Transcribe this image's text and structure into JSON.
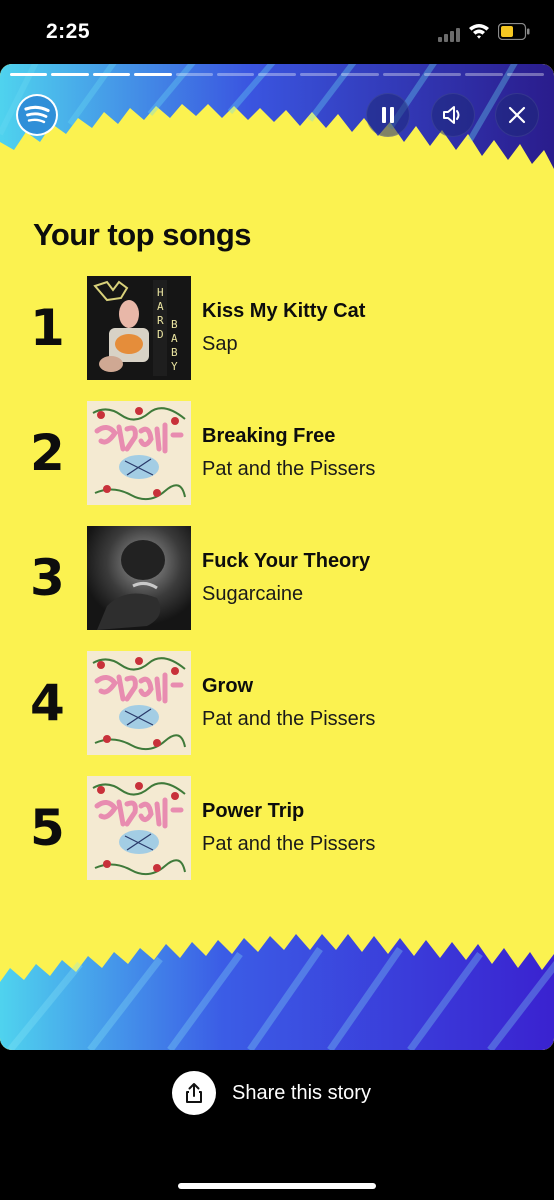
{
  "status_bar": {
    "time": "2:25",
    "cell_icon": "cellular-signal-icon",
    "wifi_icon": "wifi-icon",
    "battery_icon": "battery-low-icon",
    "battery_color": "#f5c722"
  },
  "story": {
    "progress": {
      "total_segments": 13,
      "completed_segments": 4
    },
    "logo_icon": "spotify-logo-icon",
    "controls": {
      "pause_icon": "pause-icon",
      "volume_icon": "speaker-icon",
      "close_icon": "close-icon"
    },
    "title": "Your top songs",
    "songs": [
      {
        "rank": "1",
        "title": "Kiss My Kitty Cat",
        "artist": "Sap",
        "cover": "hard-baby-cover"
      },
      {
        "rank": "2",
        "title": "Breaking Free",
        "artist": "Pat and the Pissers",
        "cover": "growth-cover"
      },
      {
        "rank": "3",
        "title": "Fuck Your Theory",
        "artist": "Sugarcaine",
        "cover": "sugarcaine-cover"
      },
      {
        "rank": "4",
        "title": "Grow",
        "artist": "Pat and the Pissers",
        "cover": "growth-cover"
      },
      {
        "rank": "5",
        "title": "Power Trip",
        "artist": "Pat and the Pissers",
        "cover": "growth-cover"
      }
    ],
    "colors": {
      "background": "#fbf250",
      "accent_blue": "#3a2fd6",
      "accent_cyan": "#4fd3ee",
      "text": "#0d0d0d"
    }
  },
  "share": {
    "label": "Share this story",
    "icon": "share-icon"
  }
}
